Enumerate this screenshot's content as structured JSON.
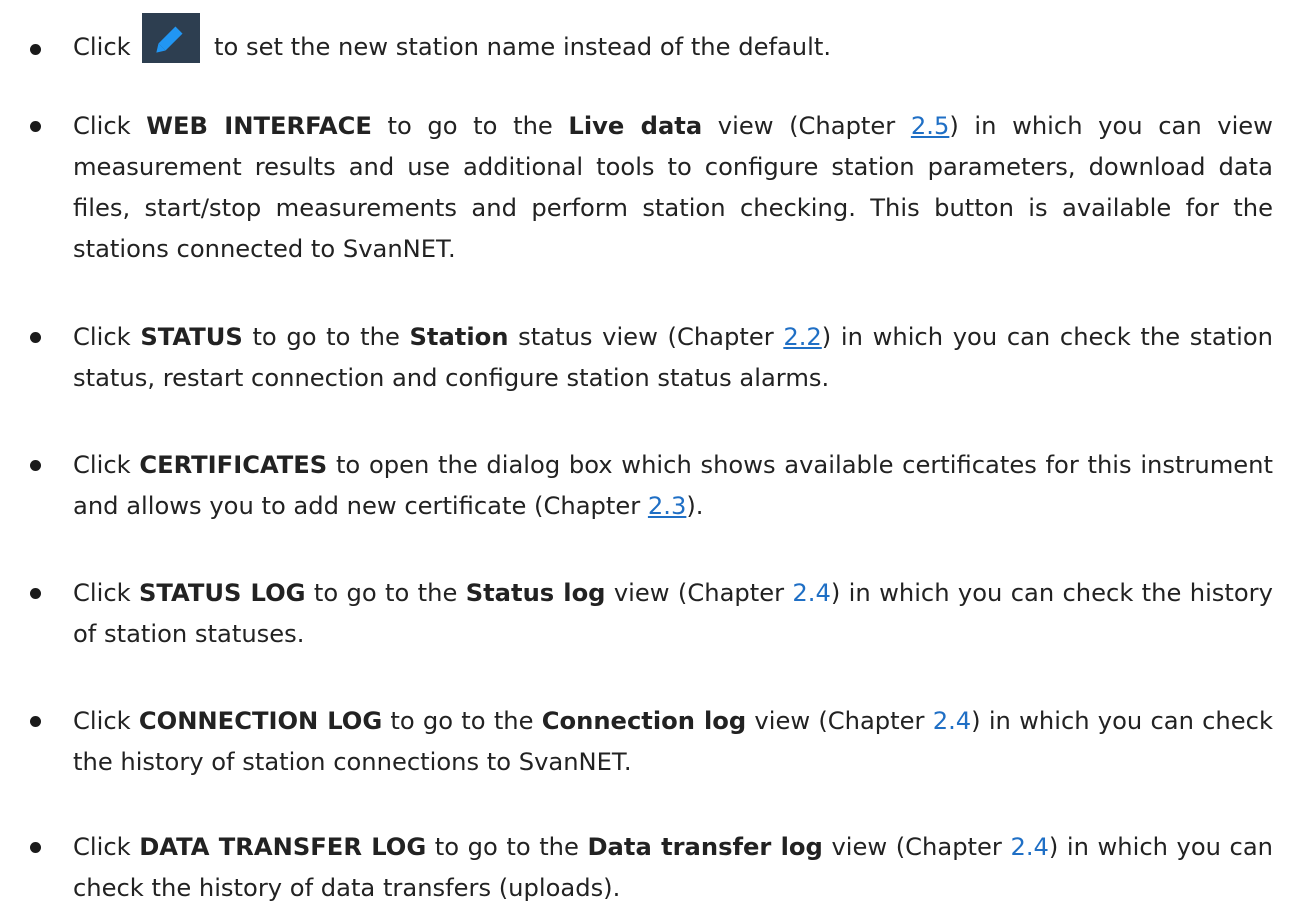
{
  "bullets": [
    {
      "click": "Click",
      "rest": "to set the new station name instead of the default.",
      "icon": "pencil-edit-icon"
    },
    {
      "click": "Click",
      "button": "WEB INTERFACE",
      "t1": "to go to the",
      "view": "Live data",
      "t2": "view (Chapter",
      "chapter": "2.5",
      "t3": ") in which you can view measurement results and use additional tools to configure station parameters, download data files, start/stop measurements and perform station checking. This button is available for the stations connected to SvanNET."
    },
    {
      "click": "Click",
      "button": "STATUS",
      "t1": "to go to the",
      "view": "Station",
      "t2": "status view (Chapter",
      "chapter": "2.2",
      "t3": ") in which you can check the station status, restart connection and configure station status alarms."
    },
    {
      "click": "Click",
      "button": "CERTIFICATES",
      "t1": "to open the dialog box which shows available certificates for this instrument and allows you to add new certificate (Chapter",
      "chapter": "2.3",
      "t3": ")."
    },
    {
      "click": "Click",
      "button": "STATUS LOG",
      "t1": "to go to the",
      "view": "Status log",
      "t2": "view (Chapter",
      "chapter": "2.4",
      "t3": ") in which you can check the history of station statuses."
    },
    {
      "click": "Click",
      "button": "CONNECTION LOG",
      "t1": "to go to the",
      "view": "Connection log",
      "t2": "view (Chapter",
      "chapter": "2.4",
      "t3": ") in which you can check the history of station connections to SvanNET."
    },
    {
      "click": "Click",
      "button": "DATA TRANSFER LOG",
      "t1": "to go to the",
      "view": "Data transfer log",
      "t2": "view (Chapter",
      "chapter": "2.4",
      "t3": ") in which you can check the history of data transfers (uploads)."
    }
  ],
  "colors": {
    "link": "#1f6fc5",
    "icon_bg": "#2d3e50",
    "icon_pencil": "#2196f3"
  }
}
